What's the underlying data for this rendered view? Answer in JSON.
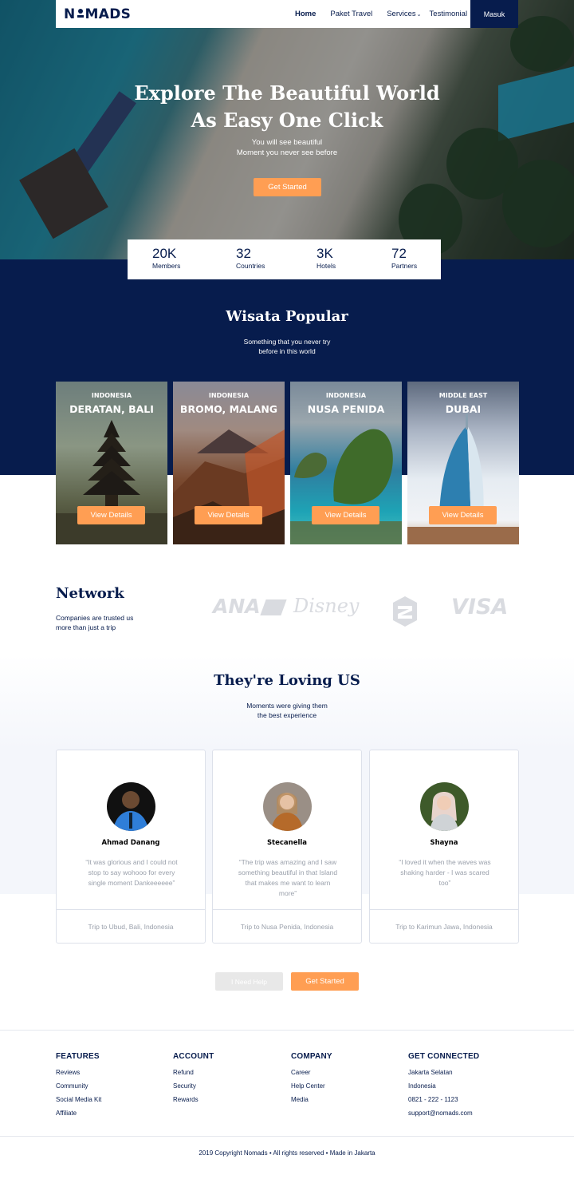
{
  "nav": {
    "logo_left": "N",
    "logo_right": "MADS",
    "links": [
      "Home",
      "Paket Travel",
      "Services",
      "Testimonial"
    ],
    "login": "Masuk"
  },
  "hero": {
    "title_line1": "Explore The Beautiful World",
    "title_line2": "As Easy One Click",
    "sub_line1": "You will see beautiful",
    "sub_line2": "Moment you never see before",
    "cta": "Get Started"
  },
  "stats": [
    {
      "value": "20K",
      "label": "Members"
    },
    {
      "value": "32",
      "label": "Countries"
    },
    {
      "value": "3K",
      "label": "Hotels"
    },
    {
      "value": "72",
      "label": "Partners"
    }
  ],
  "popular": {
    "title": "Wisata Popular",
    "sub_line1": "Something that you never try",
    "sub_line2": "before in this world",
    "cards": [
      {
        "country": "INDONESIA",
        "city": "DERATAN, BALI",
        "button": "View Details"
      },
      {
        "country": "INDONESIA",
        "city": "BROMO, MALANG",
        "button": "View Details"
      },
      {
        "country": "INDONESIA",
        "city": "NUSA PENIDA",
        "button": "View Details"
      },
      {
        "country": "MIDDLE EAST",
        "city": "DUBAI",
        "button": "View Details"
      }
    ]
  },
  "network": {
    "title": "Network",
    "sub_line1": "Companies are trusted us",
    "sub_line2": "more than just a trip",
    "brands": [
      "ANA",
      "Disney",
      "VISA"
    ]
  },
  "testimonials": {
    "title": "They're Loving US",
    "sub_line1": "Moments were giving them",
    "sub_line2": "the best experience",
    "items": [
      {
        "name": "Ahmad Danang",
        "quote": "“It was glorious and I could not stop to say wohooo for every single moment Dankeeeeee”",
        "trip": "Trip to Ubud, Bali, Indonesia"
      },
      {
        "name": "Stecanella",
        "quote": "“The trip was amazing and I saw something beautiful in that Island that makes me want to learn more”",
        "trip": "Trip to Nusa Penida, Indonesia"
      },
      {
        "name": "Shayna",
        "quote": "“I loved it when the waves was shaking harder - I was scared too”",
        "trip": "Trip to Karimun Jawa, Indonesia"
      }
    ],
    "help_button": "I Need Help",
    "start_button": "Get Started"
  },
  "footer": {
    "columns": [
      {
        "heading": "FEATURES",
        "items": [
          "Reviews",
          "Community",
          "Social Media Kit",
          "Affiliate"
        ]
      },
      {
        "heading": "ACCOUNT",
        "items": [
          "Refund",
          "Security",
          "Rewards"
        ]
      },
      {
        "heading": "COMPANY",
        "items": [
          "Career",
          "Help Center",
          "Media"
        ]
      },
      {
        "heading": "GET CONNECTED",
        "items": [
          "Jakarta Selatan",
          "Indonesia",
          "0821 - 222 - 1123",
          "support@nomads.com"
        ]
      }
    ],
    "copyright": "2019 Copyright Nomads • All rights reserved • Made in Jakarta"
  },
  "colors": {
    "navy": "#071c4d",
    "orange": "#ff9e53",
    "muted": "#9aa0ab"
  }
}
